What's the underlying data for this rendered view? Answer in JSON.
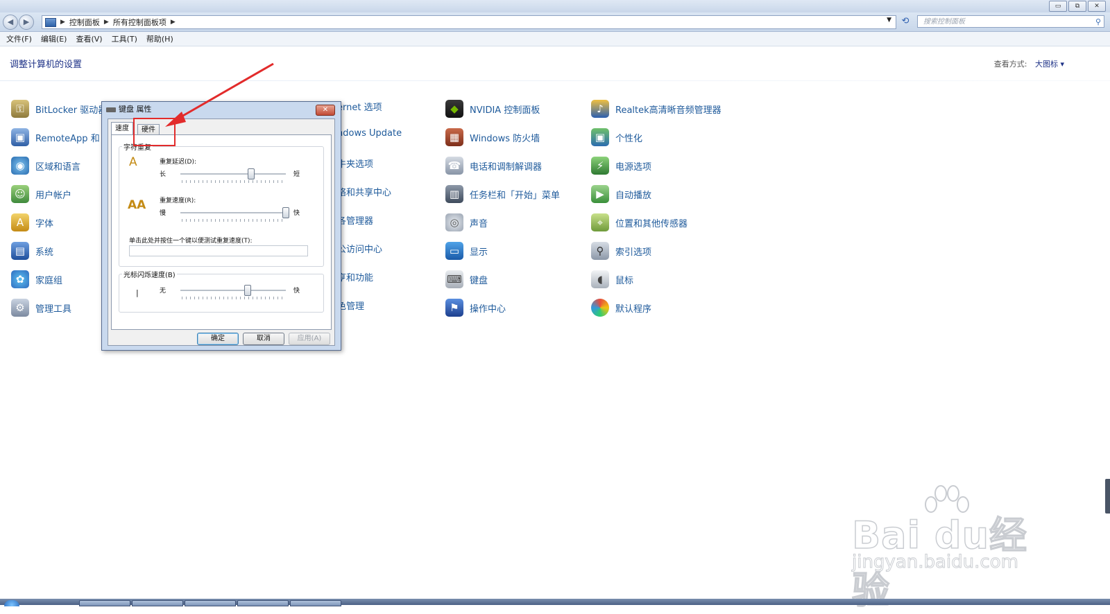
{
  "window": {
    "buttons": [
      "▭",
      "⧉",
      "✕"
    ]
  },
  "address": {
    "crumbs": [
      "控制面板",
      "所有控制面板项"
    ],
    "search_placeholder": "搜索控制面板"
  },
  "menu": [
    "文件(F)",
    "编辑(E)",
    "查看(V)",
    "工具(T)",
    "帮助(H)"
  ],
  "header": {
    "title": "调整计算机的设置",
    "view_label": "查看方式:",
    "view_value": "大图标 ▾"
  },
  "items": {
    "col1": [
      "BitLocker 驱动器",
      "RemoteApp 和",
      "区域和语言",
      "用户帐户",
      "字体",
      "系统",
      "家庭组",
      "管理工具"
    ],
    "col2": [
      "ernet 选项",
      "ndows Update",
      "牛夹选项",
      "络和共享中心",
      "各管理器",
      "公访问中心",
      "亨和功能",
      "色管理"
    ],
    "col3": [
      "NVIDIA 控制面板",
      "Windows 防火墙",
      "电话和调制解调器",
      "任务栏和「开始」菜单",
      "声音",
      "显示",
      "键盘",
      "操作中心"
    ],
    "col4": [
      "Realtek高清晰音频管理器",
      "个性化",
      "电源选项",
      "自动播放",
      "位置和其他传感器",
      "索引选项",
      "鼠标",
      "默认程序"
    ]
  },
  "dialog": {
    "title": "键盘 属性",
    "tabs": [
      "速度",
      "硬件"
    ],
    "group_repeat": "字符重复",
    "delay_label": "重复延迟(D):",
    "delay_left": "长",
    "delay_right": "短",
    "rate_label": "重复速度(R):",
    "rate_left": "慢",
    "rate_right": "快",
    "test_label": "单击此处并按住一个键以便测试重复速度(T):",
    "group_cursor": "光标闪烁速度(B)",
    "blink_left": "无",
    "blink_right": "快",
    "blink_cursor": "|",
    "buttons": {
      "ok": "确定",
      "cancel": "取消",
      "apply": "应用(A)"
    },
    "slider_levels": {
      "delay": 0.66,
      "rate": 1.0,
      "blink": 0.63
    }
  },
  "watermark": {
    "brand": "Bai du经验",
    "url": "jingyan.baidu.com"
  },
  "colors": {
    "link": "#1e5a9b",
    "heading": "#1e3287",
    "annotation": "#e22b2b"
  }
}
